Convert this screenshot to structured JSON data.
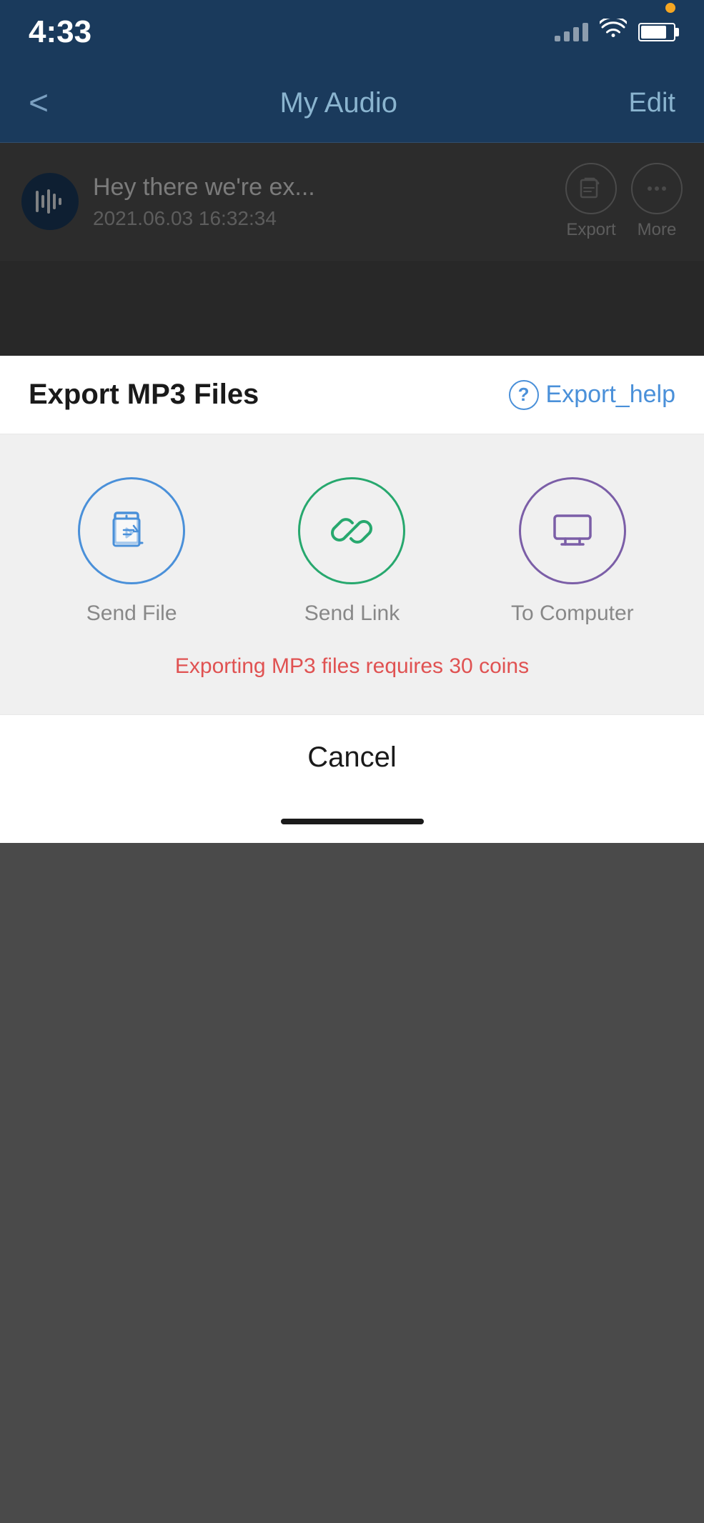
{
  "statusBar": {
    "time": "4:33"
  },
  "navBar": {
    "back": "<",
    "title": "My Audio",
    "edit": "Edit"
  },
  "audioItem": {
    "title": "Hey there we're ex...",
    "date": "2021.06.03 16:32:34",
    "exportLabel": "Export",
    "moreLabel": "More"
  },
  "exportSheet": {
    "title": "Export MP3 Files",
    "helpLabel": "Export_help",
    "helpSymbol": "?",
    "options": [
      {
        "id": "send-file",
        "label": "Send File",
        "color": "blue"
      },
      {
        "id": "send-link",
        "label": "Send Link",
        "color": "green"
      },
      {
        "id": "to-computer",
        "label": "To Computer",
        "color": "purple"
      }
    ],
    "coinsMessage": "Exporting MP3 files requires 30 coins",
    "cancelLabel": "Cancel"
  }
}
